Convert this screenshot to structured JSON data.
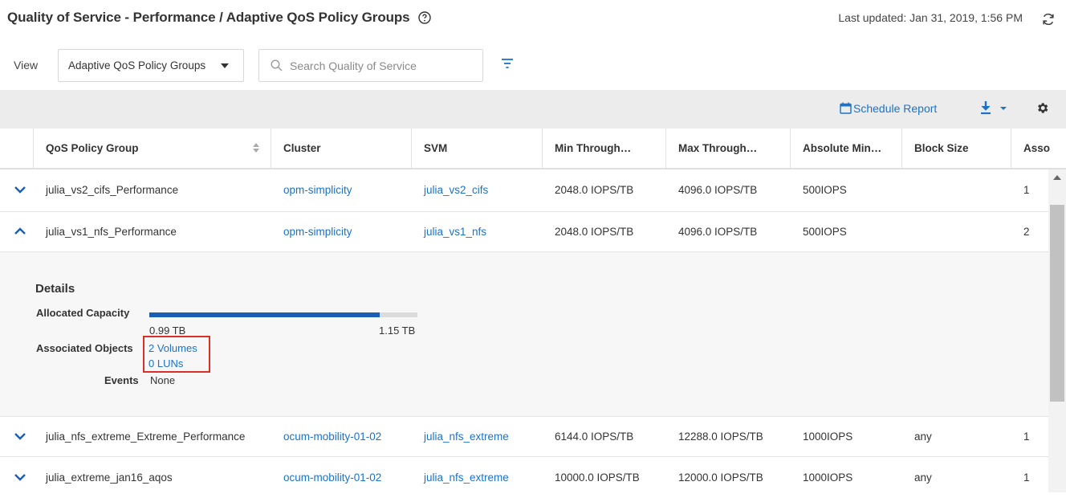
{
  "header": {
    "title": "Quality of Service - Performance / Adaptive QoS Policy Groups",
    "last_updated": "Last updated: Jan 31, 2019, 1:56 PM"
  },
  "controls": {
    "view_label": "View",
    "view_selected": "Adaptive QoS Policy Groups",
    "search_placeholder": "Search Quality of Service"
  },
  "toolbar": {
    "schedule_report_label": "Schedule Report"
  },
  "table": {
    "columns": [
      "QoS Policy Group",
      "Cluster",
      "SVM",
      "Min Through…",
      "Max Through…",
      "Absolute Min…",
      "Block Size",
      "Asso"
    ],
    "rows": [
      {
        "expanded": false,
        "policy_group": "julia_vs2_cifs_Performance",
        "cluster": "opm-simplicity",
        "svm": "julia_vs2_cifs",
        "min_throughput": "2048.0 IOPS/TB",
        "max_throughput": "4096.0 IOPS/TB",
        "absolute_min": "500IOPS",
        "block_size": "",
        "associated": "1"
      },
      {
        "expanded": true,
        "policy_group": "julia_vs1_nfs_Performance",
        "cluster": "opm-simplicity",
        "svm": "julia_vs1_nfs",
        "min_throughput": "2048.0 IOPS/TB",
        "max_throughput": "4096.0 IOPS/TB",
        "absolute_min": "500IOPS",
        "block_size": "",
        "associated": "2"
      },
      {
        "expanded": false,
        "policy_group": "julia_nfs_extreme_Extreme_Performance",
        "cluster": "ocum-mobility-01-02",
        "svm": "julia_nfs_extreme",
        "min_throughput": "6144.0 IOPS/TB",
        "max_throughput": "12288.0 IOPS/TB",
        "absolute_min": "1000IOPS",
        "block_size": "any",
        "associated": "1"
      },
      {
        "expanded": false,
        "policy_group": "julia_extreme_jan16_aqos",
        "cluster": "ocum-mobility-01-02",
        "svm": "julia_nfs_extreme",
        "min_throughput": "10000.0 IOPS/TB",
        "max_throughput": "12000.0 IOPS/TB",
        "absolute_min": "1000IOPS",
        "block_size": "any",
        "associated": "1"
      }
    ]
  },
  "details": {
    "title": "Details",
    "allocated_capacity_label": "Allocated Capacity",
    "allocated_value": "0.99 TB",
    "total_value": "1.15 TB",
    "allocated_fraction": 0.86,
    "associated_objects_label": "Associated Objects",
    "volumes_link": "2 Volumes",
    "luns_link": "0 LUNs",
    "events_label": "Events",
    "events_value": "None"
  },
  "colors": {
    "link": "#1a73c7",
    "bar_fill": "#1a5fb4",
    "highlight": "#d9302a",
    "toolbar_bg": "#ececec"
  }
}
